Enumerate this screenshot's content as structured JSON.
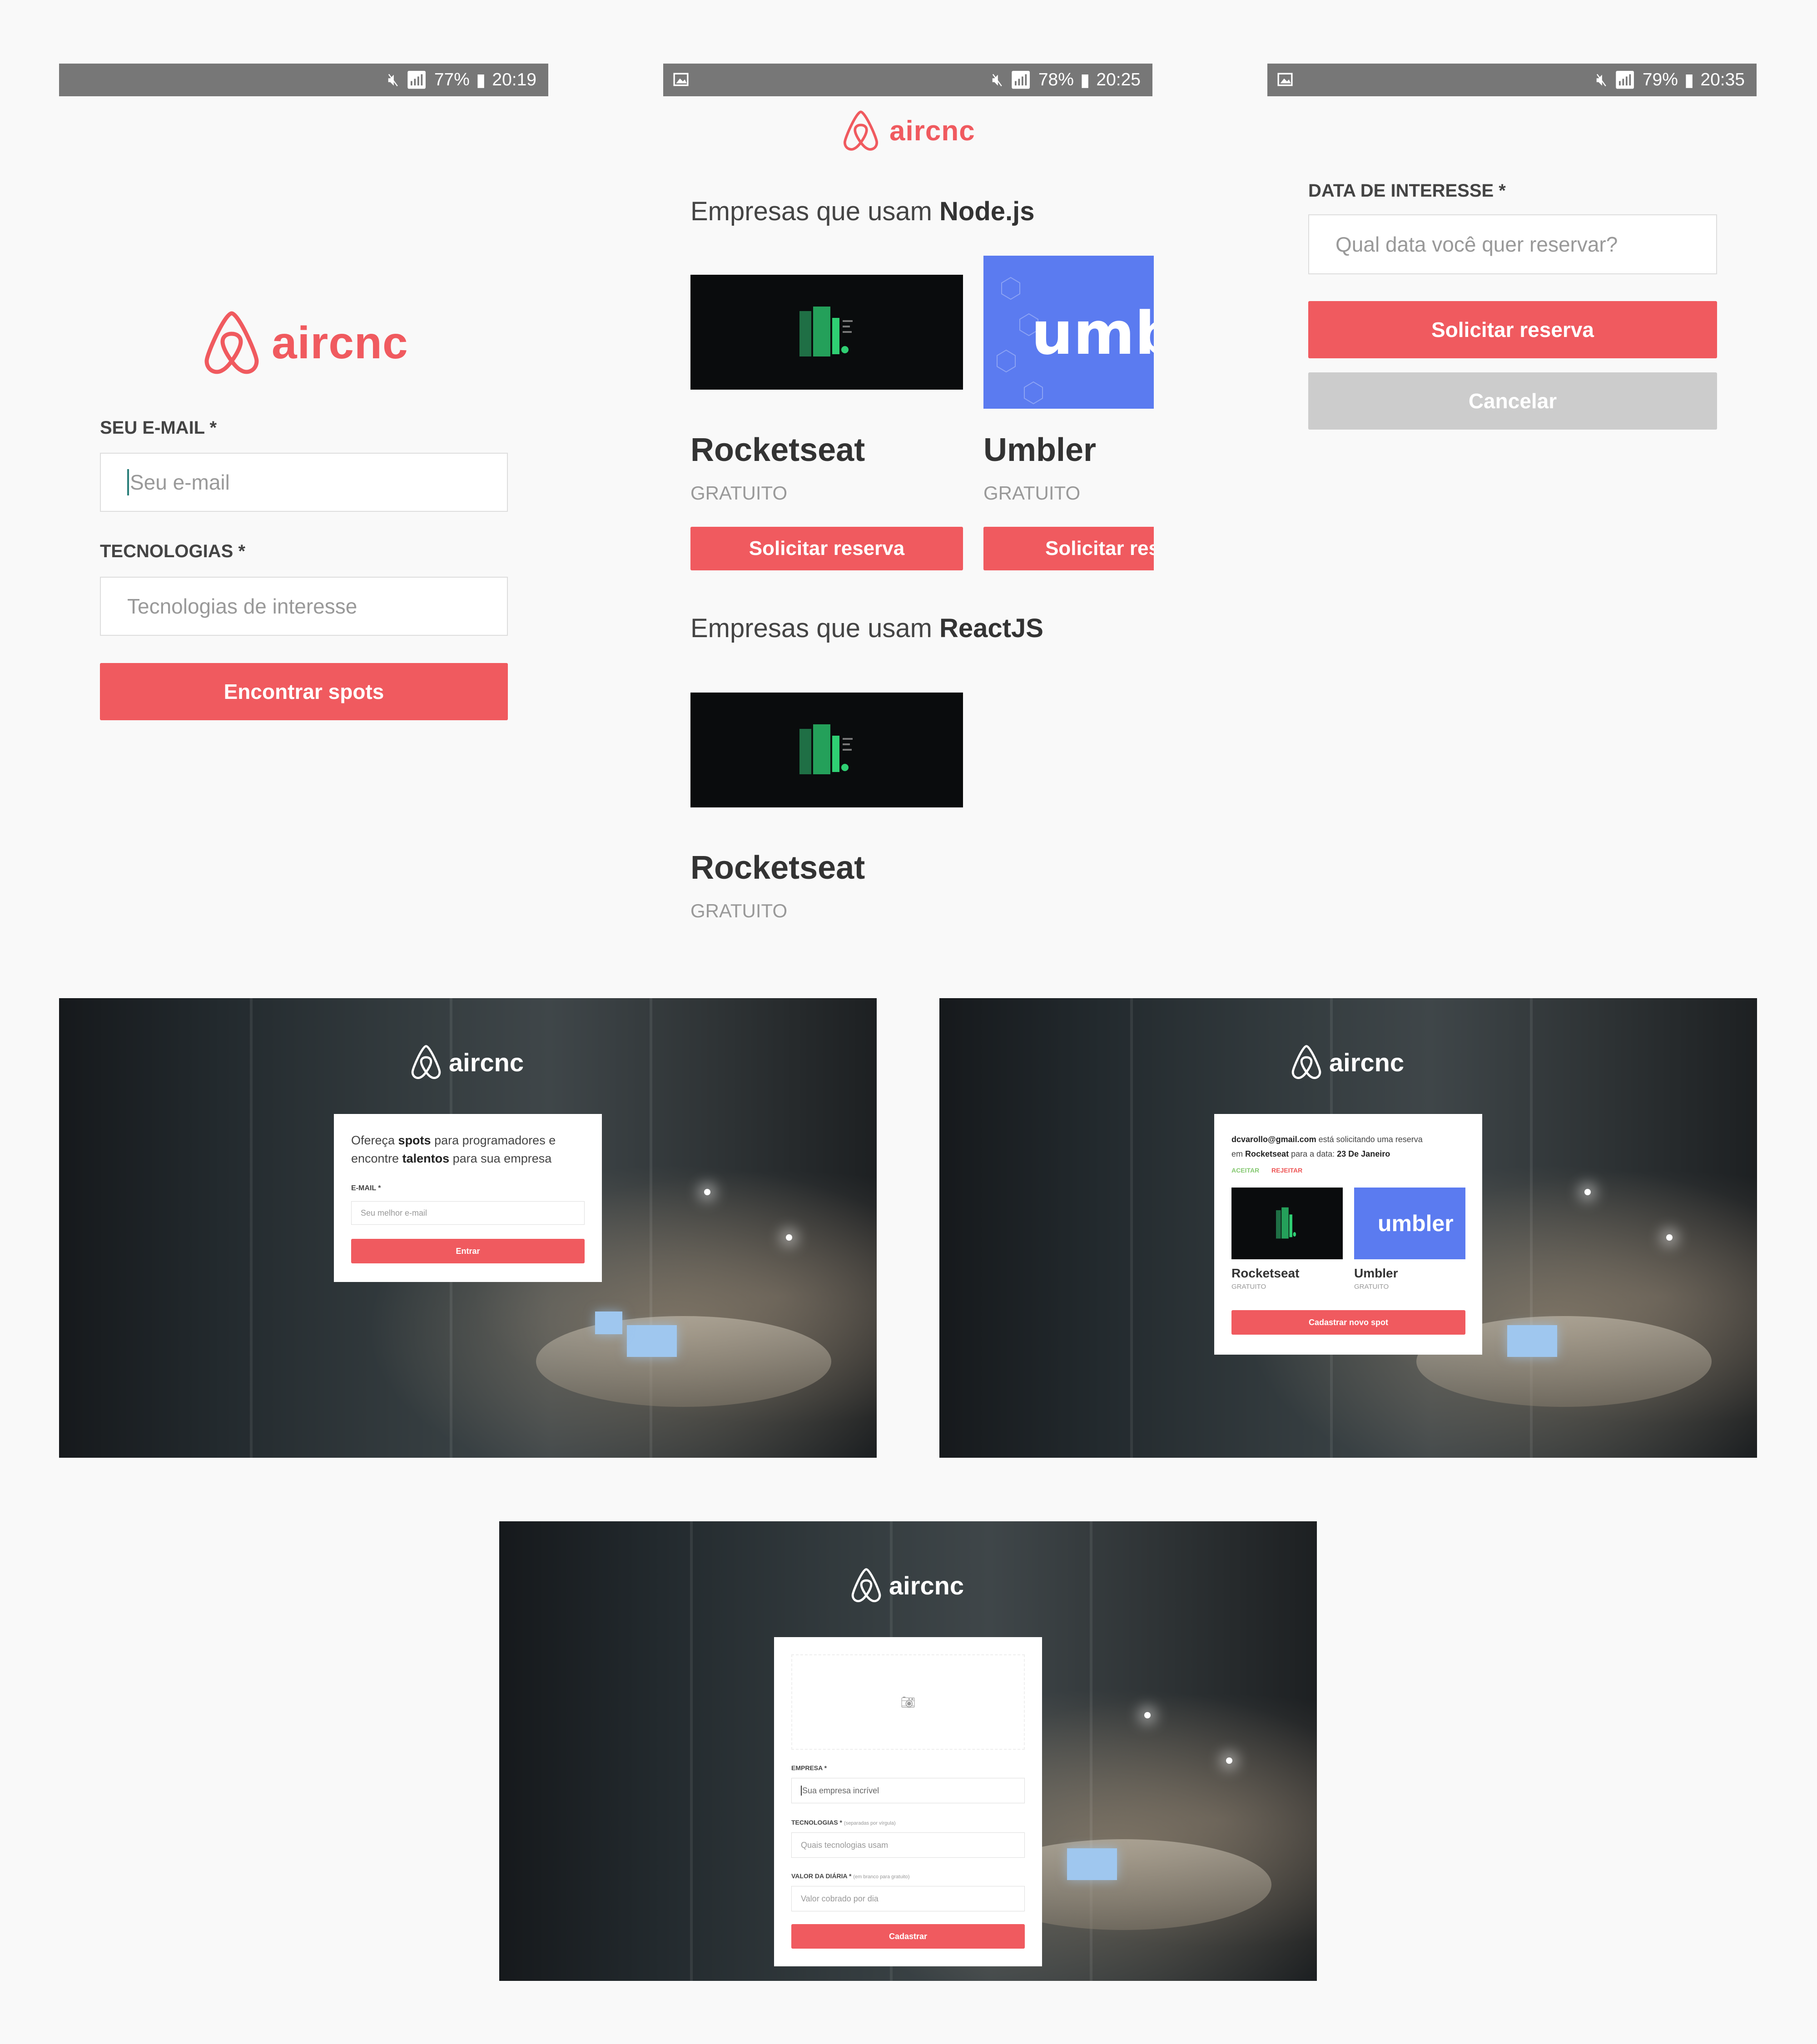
{
  "screen1": {
    "status": {
      "battery": "77%",
      "time": "20:19"
    },
    "brand": "aircnc",
    "email_label": "SEU E-MAIL *",
    "email_placeholder": "Seu e-mail",
    "tech_label": "TECNOLOGIAS *",
    "tech_placeholder": "Tecnologias de interesse",
    "submit": "Encontrar spots"
  },
  "screen2": {
    "status": {
      "battery": "78%",
      "time": "20:25"
    },
    "brand": "aircnc",
    "section1": {
      "prefix": "Empresas que usam ",
      "tech": "Node.js"
    },
    "section2": {
      "prefix": "Empresas que usam ",
      "tech": "ReactJS"
    },
    "cards1": [
      {
        "name": "Rocketseat",
        "price": "GRATUITO",
        "button": "Solicitar reserva",
        "logo": "umbl"
      },
      {
        "name": "Umbler",
        "price": "GRATUITO",
        "button": "Solicitar res"
      }
    ],
    "cards2": [
      {
        "name": "Rocketseat",
        "price": "GRATUITO"
      }
    ]
  },
  "screen3": {
    "status": {
      "battery": "79%",
      "time": "20:35"
    },
    "date_label": "DATA DE INTERESSE *",
    "date_placeholder": "Qual data você quer reservar?",
    "request": "Solicitar reserva",
    "cancel": "Cancelar"
  },
  "web_login": {
    "brand": "aircnc",
    "intro_1": "Ofereça ",
    "intro_spots": "spots",
    "intro_2": " para programadores e",
    "intro_3": "encontre ",
    "intro_talentos": "talentos",
    "intro_4": " para sua empresa",
    "email_label": "E-MAIL *",
    "email_placeholder": "Seu melhor e-mail",
    "submit": "Entrar"
  },
  "web_dashboard": {
    "brand": "aircnc",
    "notice_email": "dcvarollo@gmail.com",
    "notice_1": " está solicitando uma reserva",
    "notice_2": "em ",
    "notice_company": "Rocketseat",
    "notice_3": " para a data: ",
    "notice_date": "23 De Janeiro",
    "accept": "ACEITAR",
    "reject": "REJEITAR",
    "spots": [
      {
        "name": "Rocketseat",
        "price": "GRATUITO"
      },
      {
        "name": "Umbler",
        "price": "GRATUITO",
        "logo": "umbler"
      }
    ],
    "new_spot": "Cadastrar novo spot"
  },
  "web_new": {
    "brand": "aircnc",
    "company_label": "EMPRESA *",
    "company_placeholder": "Sua empresa incrível",
    "tech_label": "TECNOLOGIAS *",
    "tech_hint": "(separadas por vírgula)",
    "tech_placeholder": "Quais tecnologias usam",
    "price_label": "VALOR DA DIÁRIA *",
    "price_hint": "(em branco para gratuito)",
    "price_placeholder": "Valor cobrado por dia",
    "submit": "Cadastrar"
  },
  "colors": {
    "accent": "#f05a5f",
    "statusbar": "#777777",
    "umbler": "#5b7bf0"
  }
}
